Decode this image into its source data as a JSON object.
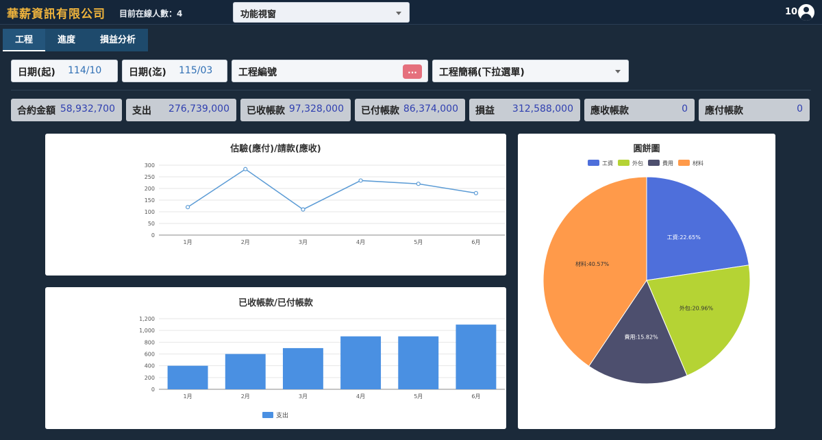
{
  "header": {
    "brand": "華薪資訊有限公司",
    "online_label": "目前在線人數：4",
    "function_select": "功能視窗",
    "user_count": "10"
  },
  "tabs": [
    {
      "label": "工程"
    },
    {
      "label": "進度"
    },
    {
      "label": "損益分析"
    }
  ],
  "filters": {
    "date_start": {
      "label": "日期(起)",
      "value": "114/10"
    },
    "date_end": {
      "label": "日期(迄)",
      "value": "115/03"
    },
    "project_no": {
      "label": "工程編號",
      "button": "..."
    },
    "project_name": {
      "label": "工程簡稱(下拉選單)"
    }
  },
  "stats": [
    {
      "label": "合約金額",
      "value": "58,932,700"
    },
    {
      "label": "支出",
      "value": "276,739,000"
    },
    {
      "label": "已收帳款",
      "value": "97,328,000"
    },
    {
      "label": "已付帳款",
      "value": "86,374,000"
    },
    {
      "label": "損益",
      "value": "312,588,000"
    },
    {
      "label": "應收帳款",
      "value": "0"
    },
    {
      "label": "應付帳款",
      "value": "0"
    }
  ],
  "chart_data": [
    {
      "type": "line",
      "title": "估驗(應付)/請款(應收)",
      "categories": [
        "1月",
        "2月",
        "3月",
        "4月",
        "5月",
        "6月"
      ],
      "values": [
        120,
        283,
        110,
        234,
        220,
        180
      ],
      "yticks": [
        "0",
        "50",
        "100",
        "150",
        "200",
        "250",
        "300"
      ],
      "ylim": [
        0,
        300
      ],
      "color": "#5b9bd5",
      "grid": true
    },
    {
      "type": "bar",
      "title": "已收帳款/已付帳款",
      "categories": [
        "1月",
        "2月",
        "3月",
        "4月",
        "5月",
        "6月"
      ],
      "series": [
        {
          "name": "支出",
          "values": [
            400,
            600,
            700,
            900,
            900,
            1100
          ]
        }
      ],
      "yticks": [
        "0",
        "200",
        "400",
        "600",
        "800",
        "1,000",
        "1,200"
      ],
      "ylim": [
        0,
        1200
      ],
      "color": "#4a90e2",
      "legend": "bottom",
      "grid": true
    },
    {
      "type": "pie",
      "title": "圓餅圖",
      "legend": "top",
      "slices": [
        {
          "name": "工資",
          "value": 22.65,
          "label": "工資:22.65%",
          "color": "#4e6fdb"
        },
        {
          "name": "外包",
          "value": 20.96,
          "label": "外包:20.96%",
          "color": "#b5d334"
        },
        {
          "name": "費用",
          "value": 15.82,
          "label": "費用:15.82%",
          "color": "#4d4f6e"
        },
        {
          "name": "材料",
          "value": 40.57,
          "label": "材料:40.57%",
          "color": "#ff9a4a"
        }
      ]
    }
  ]
}
